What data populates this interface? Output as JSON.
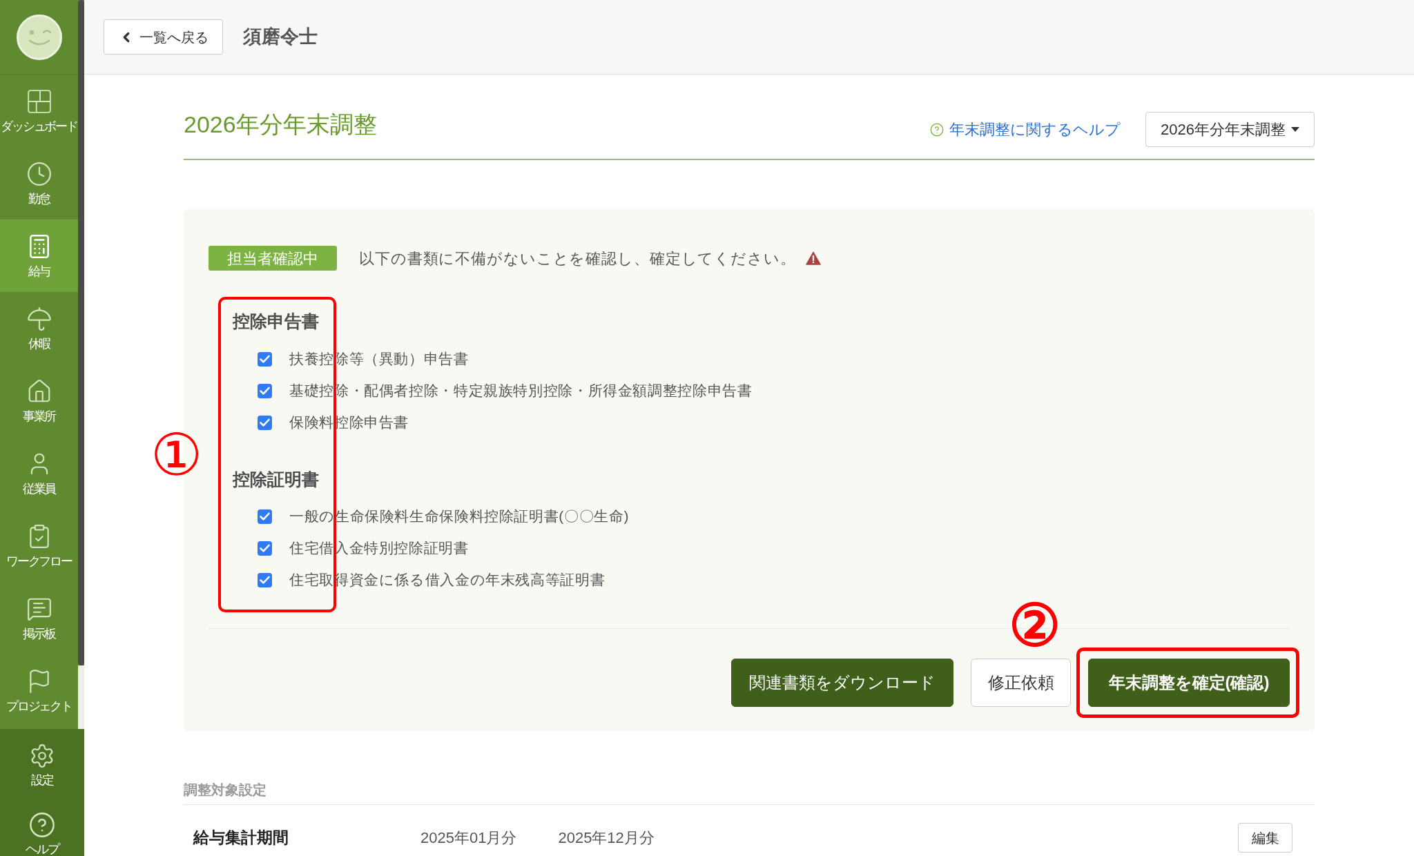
{
  "sidebar": {
    "items": [
      {
        "label": "ダッシュボード",
        "selected": false
      },
      {
        "label": "勤怠",
        "selected": false
      },
      {
        "label": "給与",
        "selected": true
      },
      {
        "label": "休暇",
        "selected": false
      },
      {
        "label": "事業所",
        "selected": false
      },
      {
        "label": "従業員",
        "selected": false
      },
      {
        "label": "ワークフロー",
        "selected": false
      },
      {
        "label": "掲示板",
        "selected": false
      },
      {
        "label": "プロジェクト",
        "selected": false
      }
    ],
    "bottom_items": [
      {
        "label": "設定",
        "selected": false
      },
      {
        "label": "ヘルプ",
        "selected": false
      }
    ]
  },
  "header": {
    "back_button": "一覧へ戻る",
    "employee_name": "須磨令士"
  },
  "page": {
    "title": "2026年分年末調整",
    "help_link": "年末調整に関するヘルプ",
    "year_select": {
      "value": "2026年分年末調整"
    }
  },
  "status_panel": {
    "badge": "担当者確認中",
    "message": "以下の書類に不備がないことを確認し、確定してください。",
    "warning": true,
    "sections": [
      {
        "heading": "控除申告書",
        "documents": [
          {
            "label": "扶養控除等（異動）申告書",
            "checked": true
          },
          {
            "label": "基礎控除・配偶者控除・特定親族特別控除・所得金額調整控除申告書",
            "checked": true
          },
          {
            "label": "保険料控除申告書",
            "checked": true
          }
        ]
      },
      {
        "heading": "控除証明書",
        "documents": [
          {
            "label": "一般の生命保険料生命保険料控除証明書(〇〇生命)",
            "checked": true
          },
          {
            "label": "住宅借入金特別控除証明書",
            "checked": true
          },
          {
            "label": "住宅取得資金に係る借入金の年末残高等証明書",
            "checked": true
          }
        ]
      }
    ],
    "buttons": [
      {
        "label": "関連書類をダウンロード",
        "kind": "primary"
      },
      {
        "label": "修正依頼",
        "kind": "secondary"
      },
      {
        "label": "年末調整を確定(確認)",
        "kind": "confirm"
      }
    ]
  },
  "annotations": [
    {
      "label": "①"
    },
    {
      "label": "②"
    }
  ],
  "target_settings": {
    "heading": "調整対象設定",
    "rows": [
      {
        "label": "給与集計期間",
        "period_start": "2025年01月分",
        "period_end": "2025年12月分",
        "edit_button": "編集"
      }
    ]
  }
}
